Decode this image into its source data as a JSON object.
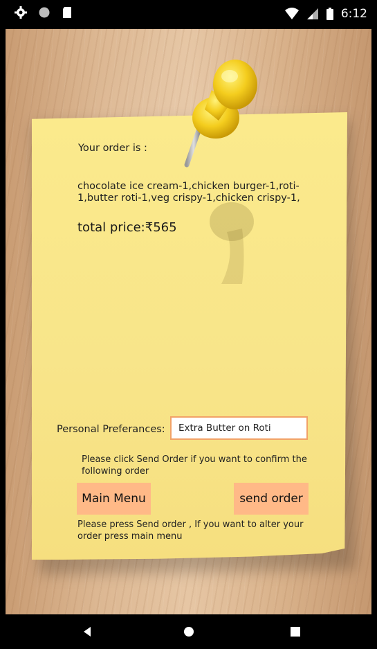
{
  "status_bar": {
    "left_icons": [
      "settings-icon",
      "circle-icon",
      "sd-card-icon"
    ],
    "right_icons": [
      "wifi-icon",
      "cellular-icon",
      "battery-icon"
    ],
    "time": "6:12"
  },
  "order": {
    "heading": "Your order is :",
    "items": "chocolate ice cream-1,chicken burger-1,roti-1,butter roti-1,veg crispy-1,chicken crispy-1,",
    "total": "total price:₹565"
  },
  "preferences": {
    "label": "Personal Preferances:",
    "value": "Extra Butter on Roti"
  },
  "messages": {
    "confirm": "Please click Send Order if you want to confirm the following order",
    "alter": "Please press Send order , If you want to alter your order press main menu"
  },
  "buttons": {
    "main_menu": "Main Menu",
    "send_order": "send order"
  },
  "colors": {
    "note": "#f8e58a",
    "button": "#ffb987",
    "input_border": "#f2a267",
    "pin": "#f4cd1e"
  }
}
